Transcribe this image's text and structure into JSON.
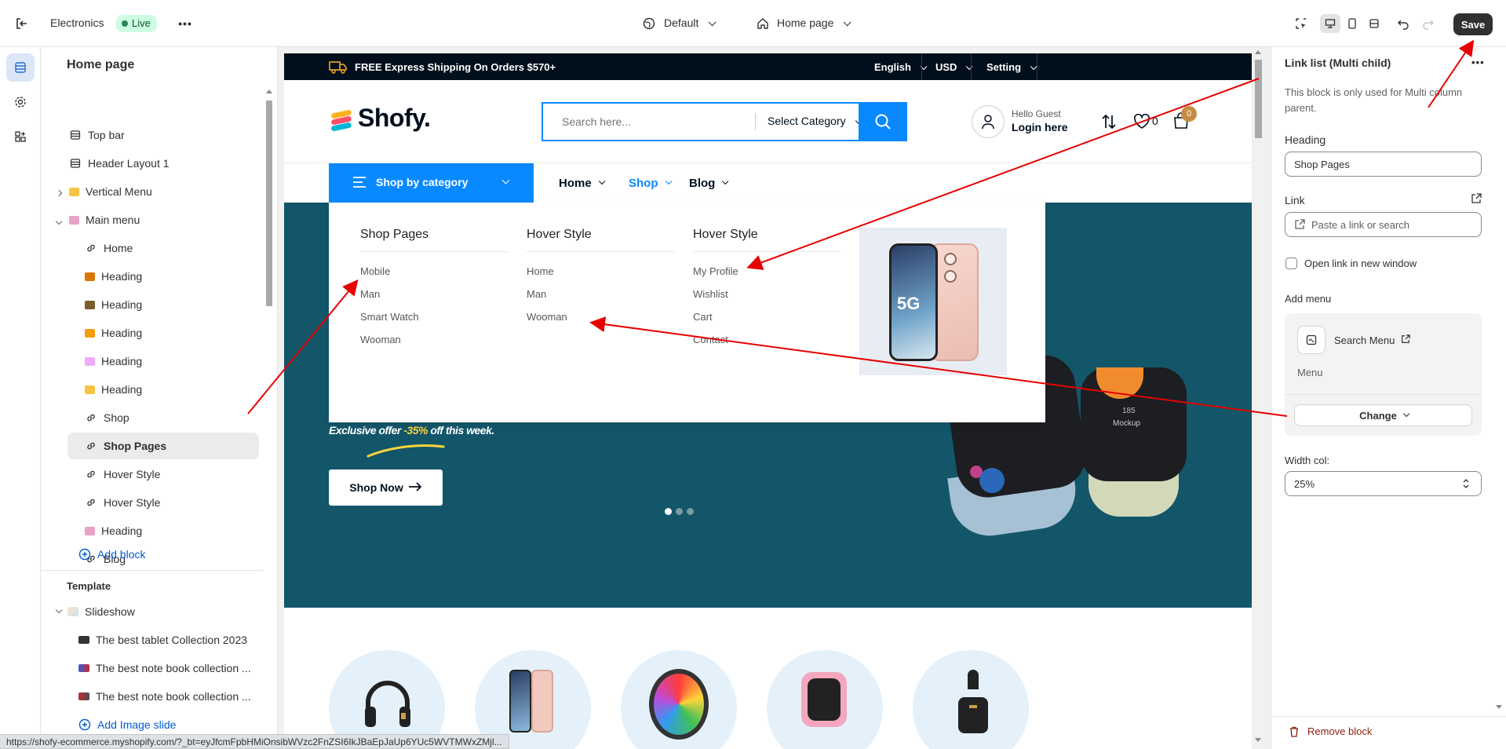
{
  "topbar": {
    "store_name": "Electronics",
    "live_badge": "Live",
    "theme_select": "Default",
    "page_select": "Home page",
    "save_label": "Save"
  },
  "sidebar": {
    "title": "Home page",
    "items": [
      {
        "label": "Top bar",
        "icon": "section-icon"
      },
      {
        "label": "Header Layout 1",
        "icon": "section-icon"
      },
      {
        "label": "Vertical Menu",
        "icon": "menu-thumb-icon"
      },
      {
        "label": "Main menu",
        "icon": "menu-thumb-icon"
      },
      {
        "label": "Home",
        "icon": "link-icon"
      },
      {
        "label": "Heading",
        "icon": "image-thumb-icon"
      },
      {
        "label": "Heading",
        "icon": "image-thumb-icon"
      },
      {
        "label": "Heading",
        "icon": "image-thumb-icon"
      },
      {
        "label": "Heading",
        "icon": "image-thumb-icon"
      },
      {
        "label": "Heading",
        "icon": "image-thumb-icon"
      },
      {
        "label": "Shop",
        "icon": "link-icon"
      },
      {
        "label": "Shop Pages",
        "icon": "link-icon"
      },
      {
        "label": "Hover Style",
        "icon": "link-icon"
      },
      {
        "label": "Hover Style",
        "icon": "link-icon"
      },
      {
        "label": "Heading",
        "icon": "image-thumb-icon"
      },
      {
        "label": "Blog",
        "icon": "link-icon"
      }
    ],
    "add_block": "Add block",
    "template_title": "Template",
    "slideshow": "Slideshow",
    "slides": [
      "The best tablet Collection 2023",
      "The best note book collection ...",
      "The best note book collection ..."
    ],
    "add_image_slide": "Add Image slide"
  },
  "site": {
    "promo": "FREE Express Shipping On Orders $570+",
    "language": "English",
    "currency": "USD",
    "setting": "Setting",
    "logo": "Shofy.",
    "search_placeholder": "Search here...",
    "select_category": "Select Category",
    "hello_guest": "Hello Guest",
    "login": "Login here",
    "wishlist_count": "0",
    "cart_count": "0",
    "shop_by_category": "Shop by category",
    "nav": [
      "Home",
      "Shop",
      "Blog"
    ],
    "mega": [
      {
        "title": "Shop Pages",
        "links": [
          "Mobile",
          "Man",
          "Smart Watch",
          "Wooman"
        ]
      },
      {
        "title": "Hover Style",
        "links": [
          "Home",
          "Man",
          "Wooman"
        ]
      },
      {
        "title": "Hover Style",
        "links": [
          "My Profile",
          "Wishlist",
          "Cart",
          "Contact"
        ]
      }
    ],
    "hero_offer_prefix": "Exclusive offer ",
    "hero_offer_pct": "-35%",
    "hero_offer_suffix": " off this week.",
    "shop_now": "Shop Now",
    "watch_brand": "Mockup",
    "watch_value": "185"
  },
  "panel": {
    "title": "Link list (Multi child)",
    "note": "This block is only used for Multi column parent.",
    "heading_label": "Heading",
    "heading_value": "Shop Pages",
    "link_label": "Link",
    "link_placeholder": "Paste a link or search",
    "checkbox_label": "Open link in new window",
    "add_menu_label": "Add menu",
    "menu_name": "Search Menu",
    "menu_sub": "Menu",
    "change_label": "Change",
    "width_label": "Width col:",
    "width_value": "25%",
    "remove_block": "Remove block"
  },
  "statusbar": {
    "url": "https://shofy-ecommerce.myshopify.com/?_bt=eyJfcmFpbHMiOnsibWVzc2FnZSI6IkJBaEpJaUp6YUc5WVTMWxZMjl..."
  },
  "colors": {
    "accent_blue": "#0989ff",
    "dark_navy": "#010f1c",
    "hero_teal": "#13566a",
    "live_green": "#cdfee1",
    "annotation_red": "#e60000"
  }
}
